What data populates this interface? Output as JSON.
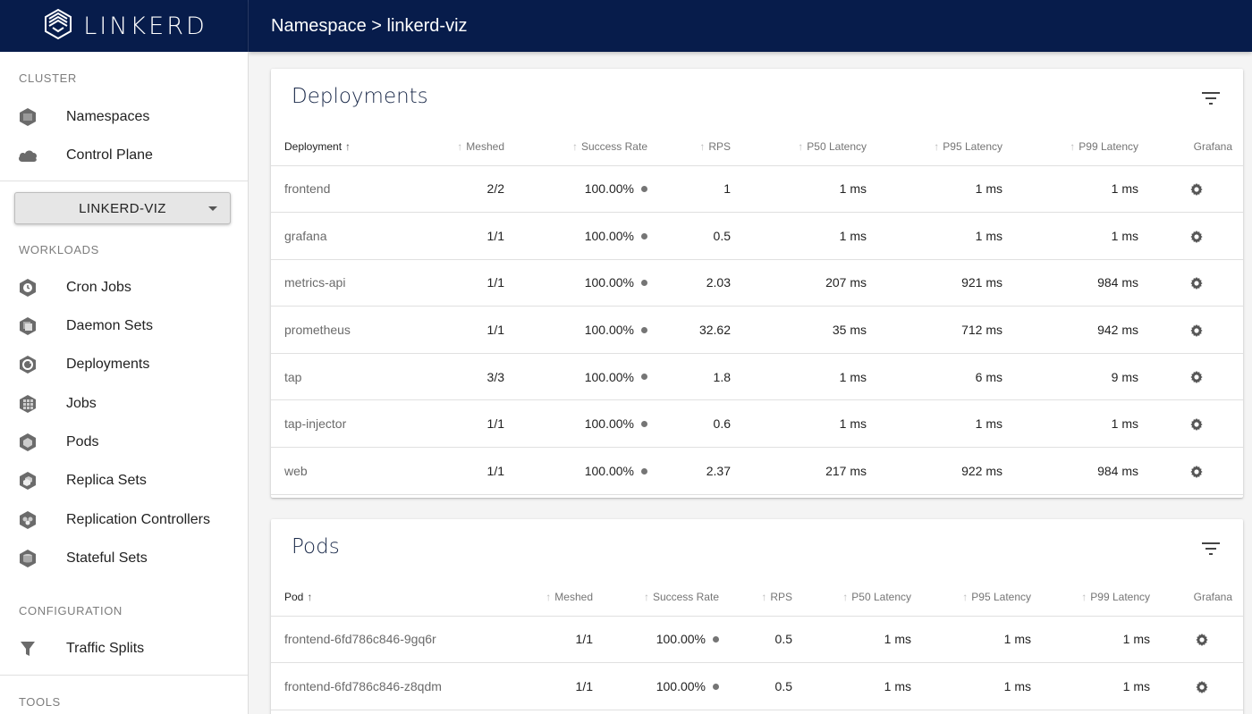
{
  "brand": {
    "name": "LINKERD"
  },
  "header": {
    "breadcrumb": "Namespace > linkerd-viz"
  },
  "sidebar": {
    "cluster_label": "CLUSTER",
    "cluster_items": [
      {
        "label": "Namespaces",
        "icon": "namespaces-icon"
      },
      {
        "label": "Control Plane",
        "icon": "cloud-icon"
      }
    ],
    "namespace_select": "LINKERD-VIZ",
    "workloads_label": "WORKLOADS",
    "workload_items": [
      {
        "label": "Cron Jobs",
        "icon": "cron-jobs-icon"
      },
      {
        "label": "Daemon Sets",
        "icon": "daemon-sets-icon"
      },
      {
        "label": "Deployments",
        "icon": "deployments-icon"
      },
      {
        "label": "Jobs",
        "icon": "jobs-icon"
      },
      {
        "label": "Pods",
        "icon": "pods-icon"
      },
      {
        "label": "Replica Sets",
        "icon": "replica-sets-icon"
      },
      {
        "label": "Replication Controllers",
        "icon": "replication-controllers-icon"
      },
      {
        "label": "Stateful Sets",
        "icon": "stateful-sets-icon"
      }
    ],
    "configuration_label": "CONFIGURATION",
    "configuration_items": [
      {
        "label": "Traffic Splits",
        "icon": "filter-funnel-icon"
      }
    ],
    "tools_label": "TOOLS"
  },
  "deployments": {
    "title": "Deployments",
    "columns": [
      "Deployment",
      "Meshed",
      "Success Rate",
      "RPS",
      "P50 Latency",
      "P95 Latency",
      "P99 Latency",
      "Grafana"
    ],
    "rows": [
      {
        "name": "frontend",
        "meshed": "2/2",
        "success_rate": "100.00%",
        "rps": "1",
        "p50": "1 ms",
        "p95": "1 ms",
        "p99": "1 ms"
      },
      {
        "name": "grafana",
        "meshed": "1/1",
        "success_rate": "100.00%",
        "rps": "0.5",
        "p50": "1 ms",
        "p95": "1 ms",
        "p99": "1 ms"
      },
      {
        "name": "metrics-api",
        "meshed": "1/1",
        "success_rate": "100.00%",
        "rps": "2.03",
        "p50": "207 ms",
        "p95": "921 ms",
        "p99": "984 ms"
      },
      {
        "name": "prometheus",
        "meshed": "1/1",
        "success_rate": "100.00%",
        "rps": "32.62",
        "p50": "35 ms",
        "p95": "712 ms",
        "p99": "942 ms"
      },
      {
        "name": "tap",
        "meshed": "3/3",
        "success_rate": "100.00%",
        "rps": "1.8",
        "p50": "1 ms",
        "p95": "6 ms",
        "p99": "9 ms"
      },
      {
        "name": "tap-injector",
        "meshed": "1/1",
        "success_rate": "100.00%",
        "rps": "0.6",
        "p50": "1 ms",
        "p95": "1 ms",
        "p99": "1 ms"
      },
      {
        "name": "web",
        "meshed": "1/1",
        "success_rate": "100.00%",
        "rps": "2.37",
        "p50": "217 ms",
        "p95": "922 ms",
        "p99": "984 ms"
      }
    ]
  },
  "pods": {
    "title": "Pods",
    "columns": [
      "Pod",
      "Meshed",
      "Success Rate",
      "RPS",
      "P50 Latency",
      "P95 Latency",
      "P99 Latency",
      "Grafana"
    ],
    "rows": [
      {
        "name": "frontend-6fd786c846-9gq6r",
        "meshed": "1/1",
        "success_rate": "100.00%",
        "rps": "0.5",
        "p50": "1 ms",
        "p95": "1 ms",
        "p99": "1 ms"
      },
      {
        "name": "frontend-6fd786c846-z8qdm",
        "meshed": "1/1",
        "success_rate": "100.00%",
        "rps": "0.5",
        "p50": "1 ms",
        "p95": "1 ms",
        "p99": "1 ms"
      }
    ]
  },
  "colors": {
    "navy": "#071c4b",
    "status_dot": "#757575"
  }
}
